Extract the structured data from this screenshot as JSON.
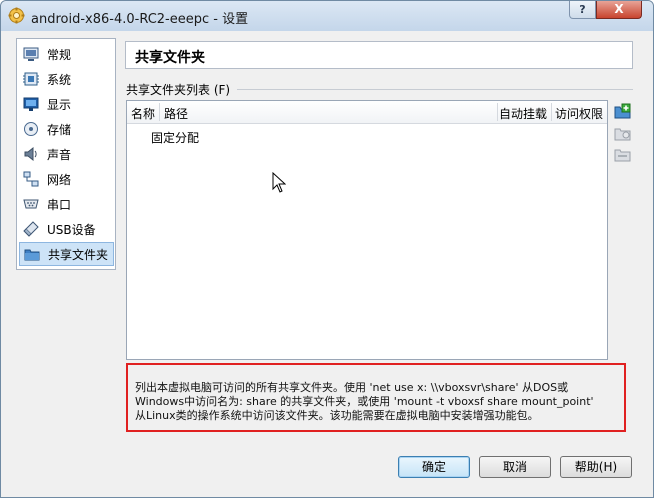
{
  "window": {
    "title": "android-x86-4.0-RC2-eeepc - 设置",
    "help_glyph": "?",
    "close_glyph": "X"
  },
  "sidebar": {
    "items": [
      {
        "label": "常规",
        "icon": "general-icon"
      },
      {
        "label": "系统",
        "icon": "system-icon"
      },
      {
        "label": "显示",
        "icon": "display-icon"
      },
      {
        "label": "存储",
        "icon": "storage-icon"
      },
      {
        "label": "声音",
        "icon": "audio-icon"
      },
      {
        "label": "网络",
        "icon": "network-icon"
      },
      {
        "label": "串口",
        "icon": "serial-port-icon"
      },
      {
        "label": "USB设备",
        "icon": "usb-icon"
      },
      {
        "label": "共享文件夹",
        "icon": "folder-icon",
        "selected": true
      }
    ]
  },
  "main": {
    "page_title": "共享文件夹",
    "list_label": "共享文件夹列表 (F)",
    "columns": [
      "名称",
      "路径",
      "自动挂载",
      "访问权限"
    ],
    "rows": [
      "固定分配"
    ],
    "toolbar_icons": [
      "add-folder-icon",
      "edit-folder-icon",
      "remove-folder-icon"
    ],
    "info_lines": [
      "列出本虚拟电脑可访问的所有共享文件夹。使用 'net use x: \\\\vboxsvr\\share' 从DOS或",
      "Windows中访问名为: share 的共享文件夹，或使用 'mount -t vboxsf share mount_point'",
      "从Linux类的操作系统中访问该文件夹。该功能需要在虚拟电脑中安装增强功能包。"
    ]
  },
  "buttons": {
    "ok": "确定",
    "cancel": "取消",
    "help": "帮助(H)"
  }
}
